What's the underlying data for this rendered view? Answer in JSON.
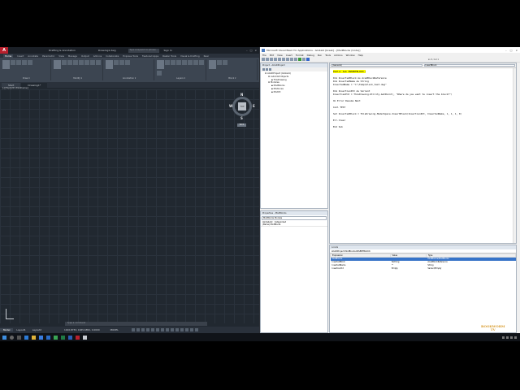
{
  "autocad": {
    "logo": "A",
    "title": "Drafting & Annotation",
    "document": "Drawing1.dwg",
    "search_placeholder": "Type a keyword or phrase",
    "user": "Sign In",
    "ribbon_tabs": [
      "Home",
      "Insert",
      "Annotate",
      "Parametric",
      "View",
      "Manage",
      "Output",
      "Add-ins",
      "Collaborate",
      "Express Tools",
      "Featured Apps",
      "Raster Tools",
      "Visual & Drafting",
      "Rear"
    ],
    "active_tab": "Home",
    "panels": [
      "Draw",
      "Modify",
      "Annotation",
      "Layers",
      "Block"
    ],
    "doc_tabs": [
      "Start",
      "Drawing1*"
    ],
    "view_label": "[-][Top][2D Wireframe]",
    "viewcube": {
      "face": "TOP",
      "n": "N",
      "s": "S",
      "e": "E",
      "w": "W",
      "wcs": "WCS"
    },
    "command_placeholder": "Type a command",
    "layout_tabs": [
      "Model",
      "Layout1",
      "Layout2"
    ],
    "active_layout": "Model",
    "coords": "1910.8753, 1965.6852, 0.0000",
    "model_label": "MODEL"
  },
  "vba": {
    "title": "Microsoft Visual Basic for Applications - Global1 [break] - [ModBlocks (Code)]",
    "menu": [
      "File",
      "Edit",
      "View",
      "Insert",
      "Format",
      "Debug",
      "Run",
      "Tools",
      "Add-Ins",
      "Window",
      "Help"
    ],
    "cursor_pos": "Ln 3, Col 1",
    "project_pane_title": "Project - ACADProject",
    "tree": [
      {
        "level": 1,
        "text": "ACADProject (Global1)"
      },
      {
        "level": 2,
        "text": "AutoCAD Objects"
      },
      {
        "level": 3,
        "text": "ThisDrawing"
      },
      {
        "level": 2,
        "text": "Modules"
      },
      {
        "level": 3,
        "text": "ModBlocks"
      },
      {
        "level": 3,
        "text": "ModLines"
      },
      {
        "level": 3,
        "text": "Mod03"
      }
    ],
    "props_title": "Properties - ModBlocks",
    "props_combo": "ModBlocks  Module",
    "props_tabs": [
      "Alphabetic",
      "Categorized"
    ],
    "props_rows": [
      "(Name)  ModBlocks"
    ],
    "code_object": "(General)",
    "code_proc": "InsertBlock",
    "code_lines": [
      {
        "text": "Public Sub INSERTBLOCK()",
        "hl": true
      },
      {
        "text": "",
        "hl": false
      },
      {
        "text": "Dim InsertedBlock As AcadBlockReference",
        "hl": false
      },
      {
        "text": "Dim InsertedName As String",
        "hl": false
      },
      {
        "text": "InsertedName = \"C:\\Temp\\block_test.dwg\"",
        "hl": false
      },
      {
        "text": "",
        "hl": false
      },
      {
        "text": "Dim InsertionPnt As Variant",
        "hl": false
      },
      {
        "text": "InsertionPnt = ThisDrawing.Utility.GetPoint(, \"Where do you want to insert the block?\")",
        "hl": false
      },
      {
        "text": "",
        "hl": false
      },
      {
        "text": "On Error Resume Next",
        "hl": false
      },
      {
        "text": "",
        "hl": false
      },
      {
        "text": "Call TEST",
        "hl": false
      },
      {
        "text": "",
        "hl": false
      },
      {
        "text": "Set InsertedBlock = ThisDrawing.ModelSpace.InsertBlock(InsertionPnt, InsertedName, 1, 1, 1, 0)",
        "hl": false
      },
      {
        "text": "",
        "hl": false
      },
      {
        "text": "Err.Clear",
        "hl": false
      },
      {
        "text": "",
        "hl": false
      },
      {
        "text": "End Sub",
        "hl": false
      }
    ],
    "locals_title": "Locals",
    "locals_context": "ACADProject.ModBlocks.INSERTBLOCK",
    "locals_headers": [
      "Expression",
      "Value",
      "Type"
    ],
    "locals_rows": [
      {
        "expr": "ModBlocks",
        "value": "",
        "type": "ModBlocks/ModBlocks",
        "sel": true
      },
      {
        "expr": "InsertedBlock",
        "value": "Nothing",
        "type": "AcadBlockReference",
        "sel": false
      },
      {
        "expr": "InsertedName",
        "value": "\"\"",
        "type": "String",
        "sel": false
      },
      {
        "expr": "InsertionPnt",
        "value": "Empty",
        "type": "Variant/Empty",
        "sel": false
      }
    ]
  },
  "watermark": "BOOKWORM\nTV"
}
